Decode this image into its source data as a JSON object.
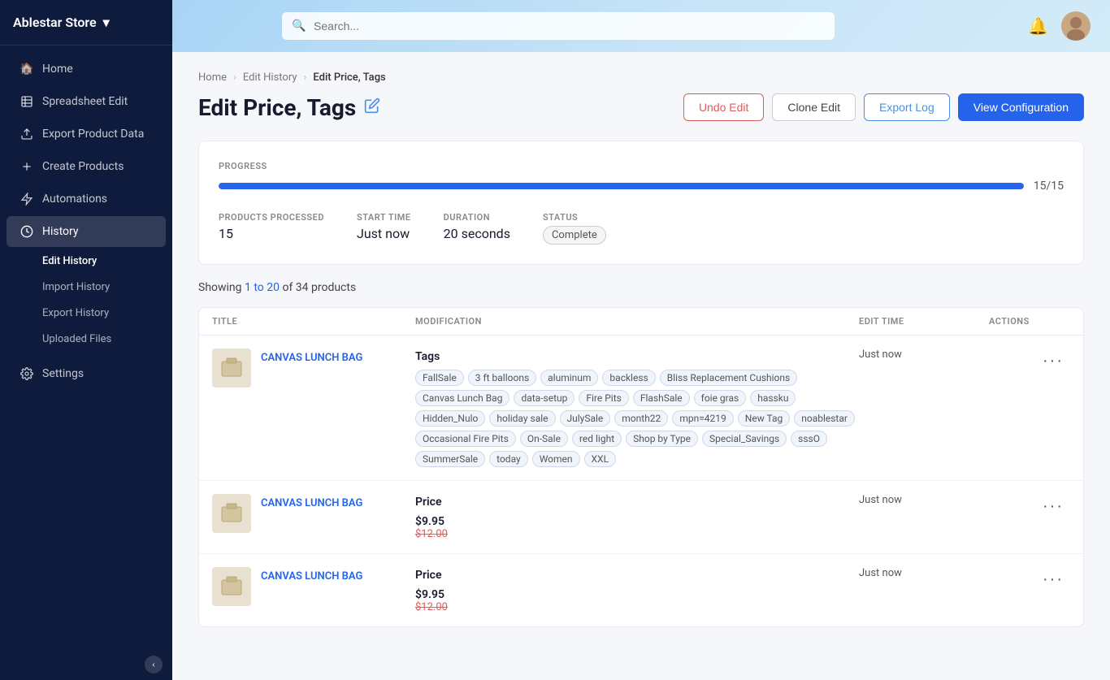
{
  "brand": {
    "name": "Ablestar Store",
    "chevron": "▾"
  },
  "sidebar": {
    "items": [
      {
        "id": "home",
        "label": "Home",
        "icon": "🏠",
        "active": false
      },
      {
        "id": "spreadsheet-edit",
        "label": "Spreadsheet Edit",
        "icon": "📋",
        "active": false
      },
      {
        "id": "export-product-data",
        "label": "Export Product Data",
        "icon": "⬆",
        "active": false
      },
      {
        "id": "create-products",
        "label": "Create Products",
        "icon": "✚",
        "active": false
      },
      {
        "id": "automations",
        "label": "Automations",
        "icon": "⚡",
        "active": false
      },
      {
        "id": "history",
        "label": "History",
        "icon": "⏱",
        "active": true
      }
    ],
    "sub_items": [
      {
        "id": "edit-history",
        "label": "Edit History",
        "active": true
      },
      {
        "id": "import-history",
        "label": "Import History",
        "active": false
      },
      {
        "id": "export-history",
        "label": "Export History",
        "active": false
      },
      {
        "id": "uploaded-files",
        "label": "Uploaded Files",
        "active": false
      }
    ],
    "settings": {
      "label": "Settings",
      "icon": "⚙"
    }
  },
  "topbar": {
    "search_placeholder": "Search..."
  },
  "breadcrumb": {
    "items": [
      {
        "label": "Home",
        "link": true
      },
      {
        "label": "Edit History",
        "link": true
      },
      {
        "label": "Edit Price, Tags",
        "link": false
      }
    ]
  },
  "page": {
    "title": "Edit Price, Tags",
    "buttons": {
      "undo": "Undo Edit",
      "clone": "Clone Edit",
      "export_log": "Export Log",
      "view_config": "View Configuration"
    }
  },
  "progress": {
    "label": "PROGRESS",
    "fill_percent": 100,
    "count": "15/15"
  },
  "stats": {
    "products_processed": {
      "label": "PRODUCTS PROCESSED",
      "value": "15"
    },
    "start_time": {
      "label": "START TIME",
      "value": "Just now"
    },
    "duration": {
      "label": "DURATION",
      "value": "20 seconds"
    },
    "status": {
      "label": "STATUS",
      "value": "Complete"
    }
  },
  "showing": {
    "prefix": "Showing ",
    "range": "1 to 20",
    "suffix": " of 34 products"
  },
  "table": {
    "headers": [
      "TITLE",
      "MODIFICATION",
      "EDIT TIME",
      "ACTIONS"
    ],
    "rows": [
      {
        "id": "row-1",
        "product_name": "CANVAS LUNCH BAG",
        "mod_type": "Tags",
        "tags": [
          "FallSale",
          "3 ft balloons",
          "aluminum",
          "backless",
          "Bliss Replacement Cushions",
          "Canvas Lunch Bag",
          "data-setup",
          "Fire Pits",
          "FlashSale",
          "foie gras",
          "hassku",
          "Hidden_Nulo",
          "holiday sale",
          "JulySale",
          "month22",
          "mpn=4219",
          "New Tag",
          "noablestar",
          "Occasional Fire Pits",
          "On-Sale",
          "red light",
          "Shop by Type",
          "Special_Savings",
          "sssO",
          "SummerSale",
          "today",
          "Women",
          "XXL"
        ],
        "edit_time": "Just now",
        "has_price": false
      },
      {
        "id": "row-2",
        "product_name": "CANVAS LUNCH BAG",
        "mod_type": "Price",
        "price_new": "$9.95",
        "price_old": "$12.00",
        "edit_time": "Just now",
        "has_price": true,
        "tags": []
      },
      {
        "id": "row-3",
        "product_name": "CANVAS LUNCH BAG",
        "mod_type": "Price",
        "price_new": "$9.95",
        "price_old": "$12.00",
        "edit_time": "Just now",
        "has_price": true,
        "tags": []
      }
    ]
  },
  "colors": {
    "accent_blue": "#2563eb",
    "sidebar_bg": "#0f1b3c",
    "tag_bg": "#f0f4fb",
    "tag_border": "#d0d8e8",
    "red": "#e05c5c"
  }
}
